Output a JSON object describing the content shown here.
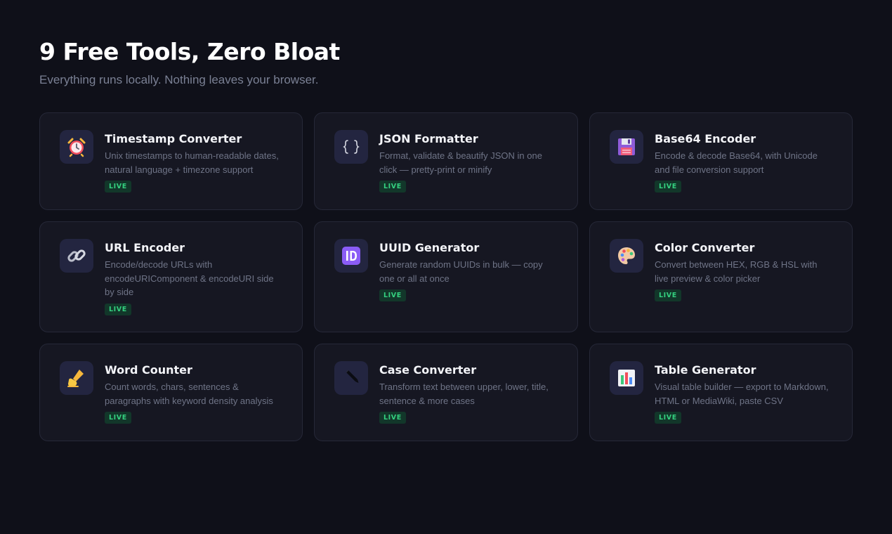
{
  "header": {
    "title": "9 Free Tools, Zero Bloat",
    "subtitle": "Everything runs locally. Nothing leaves your browser."
  },
  "tools": [
    {
      "title": "Timestamp Converter",
      "description": "Unix timestamps to human-readable dates, natural language + timezone support",
      "badge": "LIVE",
      "icon": "alarm-clock-icon"
    },
    {
      "title": "JSON Formatter",
      "description": "Format, validate & beautify JSON in one click — pretty-print or minify",
      "badge": "LIVE",
      "icon": "curly-braces-icon"
    },
    {
      "title": "Base64 Encoder",
      "description": "Encode & decode Base64, with Unicode and file conversion support",
      "badge": "LIVE",
      "icon": "floppy-disk-icon"
    },
    {
      "title": "URL Encoder",
      "description": "Encode/decode URLs with encodeURIComponent & encodeURI side by side",
      "badge": "LIVE",
      "icon": "link-icon"
    },
    {
      "title": "UUID Generator",
      "description": "Generate random UUIDs in bulk — copy one or all at once",
      "badge": "LIVE",
      "icon": "id-button-icon"
    },
    {
      "title": "Color Converter",
      "description": "Convert between HEX, RGB & HSL with live preview & color picker",
      "badge": "LIVE",
      "icon": "palette-icon"
    },
    {
      "title": "Word Counter",
      "description": "Count words, chars, sentences & paragraphs with keyword density analysis",
      "badge": "LIVE",
      "icon": "writing-hand-icon"
    },
    {
      "title": "Case Converter",
      "description": "Transform text between upper, lower, title, sentence & more cases",
      "badge": "LIVE",
      "icon": "pencil-icon"
    },
    {
      "title": "Table Generator",
      "description": "Visual table builder — export to Markdown, HTML or MediaWiki, paste CSV",
      "badge": "LIVE",
      "icon": "bar-chart-icon"
    }
  ],
  "colors": {
    "background": "#0f1019",
    "card": "#161722",
    "card_border": "#262838",
    "icon_box": "#232540",
    "badge_bg": "#12372a",
    "badge_text": "#34d07f"
  }
}
